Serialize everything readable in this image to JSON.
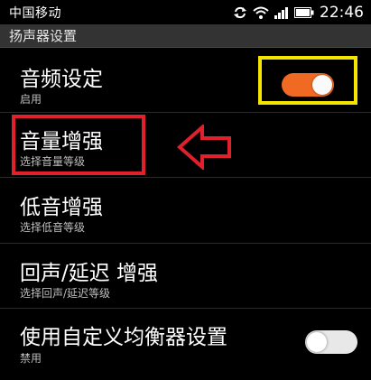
{
  "status_bar": {
    "carrier": "中国移动",
    "time": "22:46",
    "icons": [
      "sync-icon",
      "wifi-icon",
      "signal-icon",
      "battery-icon"
    ]
  },
  "section_header": "扬声器设置",
  "settings": [
    {
      "title": "音频设定",
      "subtitle": "启用",
      "toggle": "on"
    },
    {
      "title": "音量增强",
      "subtitle": "选择音量等级"
    },
    {
      "title": "低音增强",
      "subtitle": "选择低音等级"
    },
    {
      "title": "回声/延迟 增强",
      "subtitle": "选择回声/延迟等级"
    },
    {
      "title": "使用自定义均衡器设置",
      "subtitle": "禁用",
      "toggle": "off"
    }
  ],
  "colors": {
    "toggle_on": "#f06a24",
    "toggle_off": "#e8e8e8",
    "highlight_yellow": "#f5e400",
    "highlight_red": "#e0202a"
  }
}
